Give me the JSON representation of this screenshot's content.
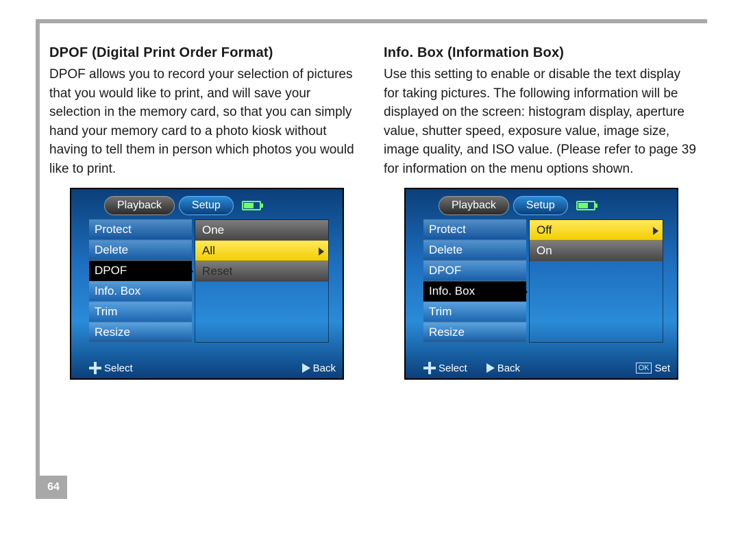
{
  "page_number": "64",
  "left": {
    "heading": "DPOF (Digital Print Order Format)",
    "body": "DPOF allows you to record your selection of pictures that you would like to print, and will save your selection in the memory card, so that you can simply hand your memory card to a photo kiosk without having to tell them in person which photos you would like to print.",
    "screen": {
      "tabs": {
        "playback": "Playback",
        "setup": "Setup"
      },
      "menu": [
        "Protect",
        "Delete",
        "DPOF",
        "Info. Box",
        "Trim",
        "Resize"
      ],
      "selected": "DPOF",
      "options": [
        {
          "label": "One",
          "highlight": false
        },
        {
          "label": "All",
          "highlight": true
        },
        {
          "label": "Reset",
          "highlight": false,
          "dim": true
        }
      ],
      "hints": {
        "select": "Select",
        "back": "Back"
      }
    }
  },
  "right": {
    "heading": "Info. Box (Information Box)",
    "body": "Use this setting to enable or disable the text display for taking pictures. The following information will be displayed on the screen: histogram display, aperture value, shutter speed, exposure value, image size, image quality, and ISO value. (Please refer to page 39 for information on the menu options shown.",
    "screen": {
      "tabs": {
        "playback": "Playback",
        "setup": "Setup"
      },
      "menu": [
        "Protect",
        "Delete",
        "DPOF",
        "Info. Box",
        "Trim",
        "Resize"
      ],
      "selected": "Info. Box",
      "options": [
        {
          "label": "Off",
          "highlight": true
        },
        {
          "label": "On",
          "highlight": false
        }
      ],
      "hints": {
        "select": "Select",
        "back": "Back",
        "set": "Set"
      }
    }
  }
}
